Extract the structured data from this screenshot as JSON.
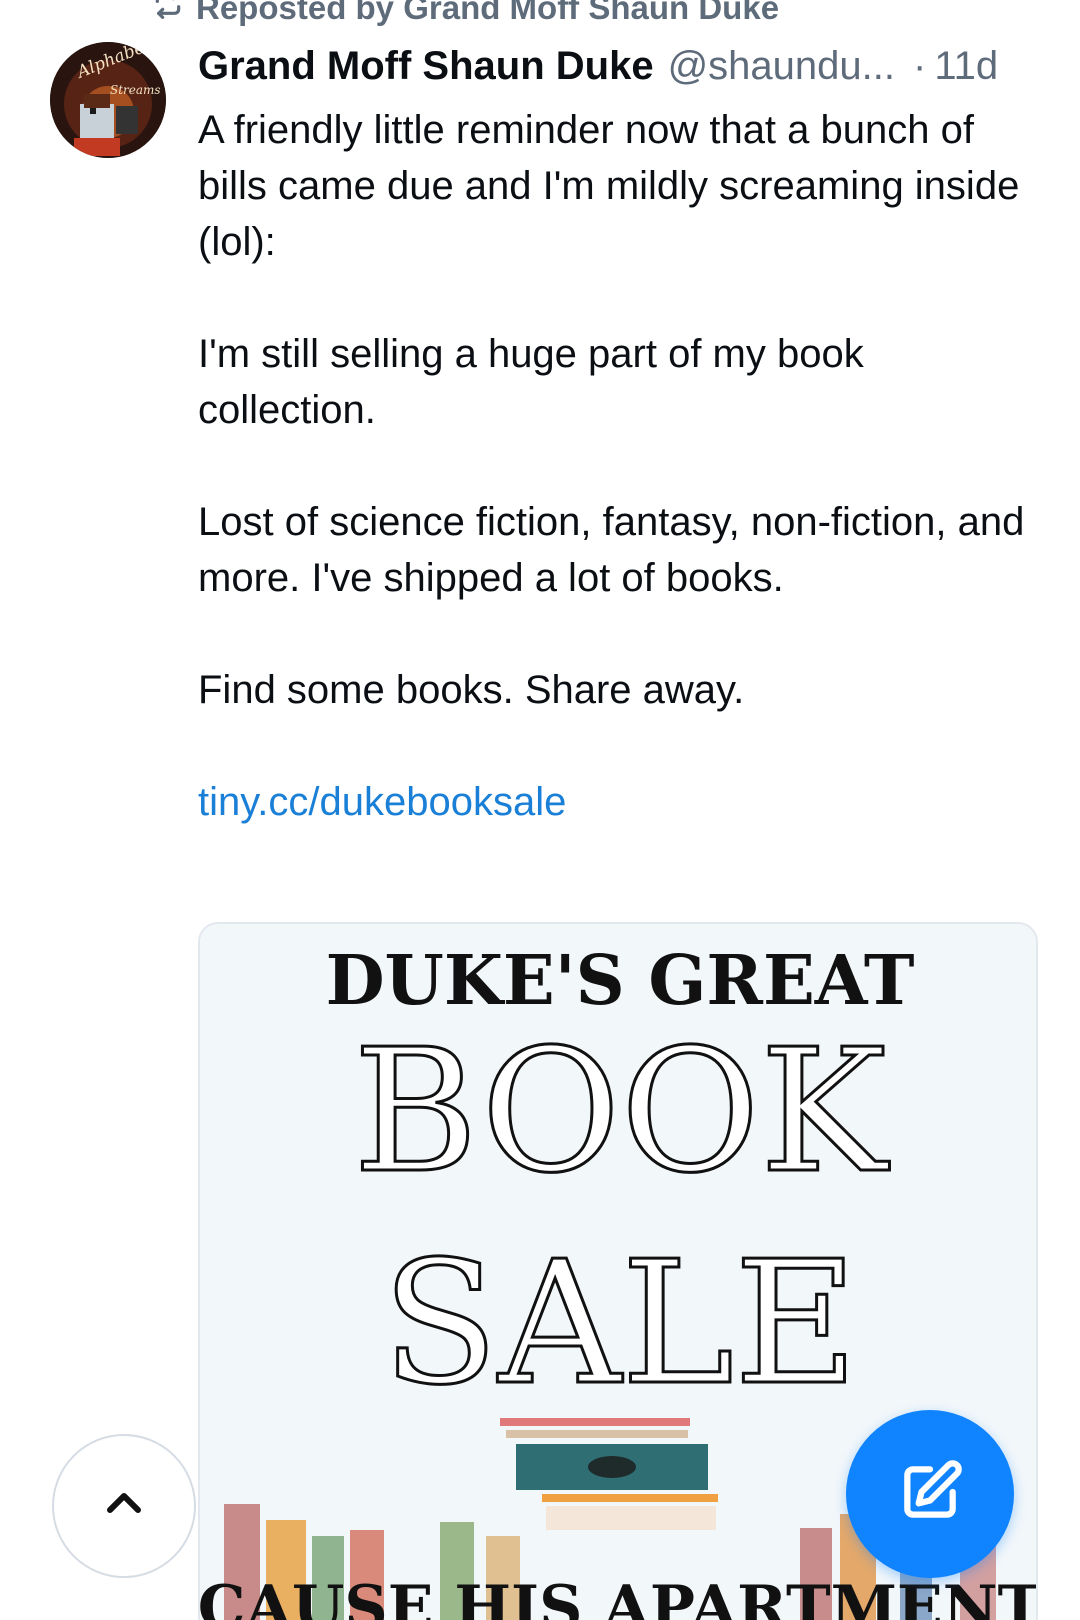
{
  "repost": {
    "label": "Reposted by Grand Moff Shaun Duke",
    "icon": "repost-icon"
  },
  "post": {
    "author": {
      "display_name": "Grand Moff Shaun Duke",
      "handle": "@shaundu...",
      "avatar_lettering": [
        "Alphabet",
        "Streams"
      ]
    },
    "separator": "·",
    "time": "11d",
    "paragraphs": [
      "A friendly little reminder now that a bunch of bills came due and I'm mildly screaming inside (lol):",
      "I'm still selling a huge part of my book collection.",
      "Lost of science fiction, fantasy, non-fiction, and more. I've shipped a lot of books.",
      "Find some books. Share away."
    ],
    "link": "tiny.cc/dukebooksale",
    "image": {
      "lines": [
        "DUKE'S GREAT",
        "BOOK",
        "SALE",
        "CAUSE HIS APARTMENT"
      ]
    }
  },
  "controls": {
    "scroll_top_icon": "chevron-up-icon",
    "compose_icon": "compose-icon"
  },
  "colors": {
    "link": "#1a7fd6",
    "fab": "#1083fe",
    "muted": "#5e6b7a"
  }
}
